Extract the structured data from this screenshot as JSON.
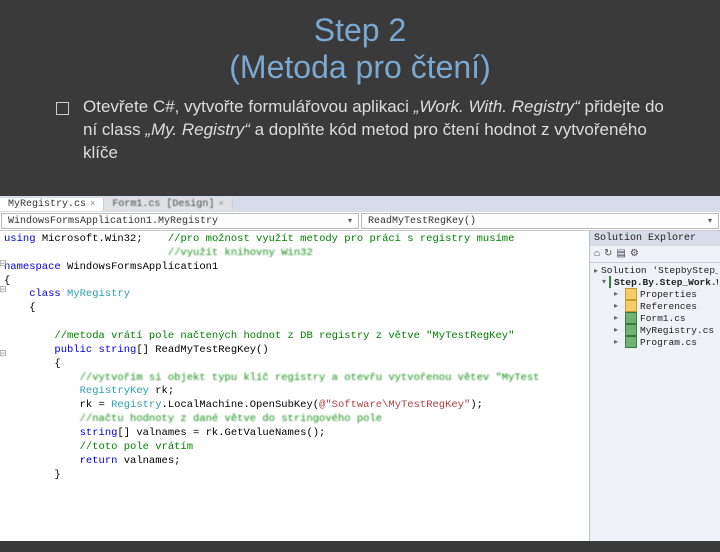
{
  "title_line1": "Step 2",
  "title_line2": "(Metoda pro čtení)",
  "bullet": {
    "pre": "Otevřete C#, vytvořte formulářovou aplikaci ",
    "app": "„Work. With. Registry“",
    "mid": " přidejte do ní class ",
    "cls": "„My. Registry“",
    "post": " a doplňte kód metod pro čtení hodnot z vytvořeného klíče"
  },
  "ide": {
    "tabs": [
      "MyRegistry.cs",
      "Form1.cs [Design]"
    ],
    "combo_left": "WindowsFormsApplication1.MyRegistry",
    "combo_right": "ReadMyTestRegKey()",
    "code": {
      "l1a": "using",
      "l1b": " Microsoft.Win32;    ",
      "l1c": "//pro možnost využít metody pro práci s registry musíme",
      "l2c_blur": "//využít knihovny Win32",
      "l3a": "namespace",
      "l3b": " WindowsFormsApplication1",
      "l4": "{",
      "l5a": "    class",
      "l5b": " MyRegistry",
      "l6": "    {",
      "l8c": "        //metoda vrátí pole načtených hodnot z DB registry z větve \"MyTestRegKey\"",
      "l9a": "        public",
      "l9b": " string",
      "l9c": "[] ReadMyTestRegKey()",
      "l10": "        {",
      "l11c_blur": "            //vytvořím si objekt typu klíč registry a otevřu vytvořenou větev \"MyTest",
      "l12a": "            RegistryKey",
      "l12b": " rk;",
      "l13a": "            rk = ",
      "l13b": "Registry",
      "l13c": ".LocalMachine.OpenSubKey(",
      "l13d": "@\"Software\\MyTestRegKey\"",
      "l13e": ");",
      "l14c_blur": "            //načtu hodnoty z dané větve do stringového pole",
      "l15a": "            string",
      "l15b": "[] valnames = rk.GetValueNames();",
      "l16c": "            //toto pole vrátím",
      "l17a": "            return",
      "l17b": " valnames;",
      "l18": "        }"
    },
    "solution": {
      "header": "Solution Explorer",
      "root": "Solution 'StepbyStep_WorkWi",
      "project": "Step.By.Step_Work.With.R",
      "nodes": [
        "Properties",
        "References",
        "Form1.cs",
        "MyRegistry.cs",
        "Program.cs"
      ]
    }
  }
}
